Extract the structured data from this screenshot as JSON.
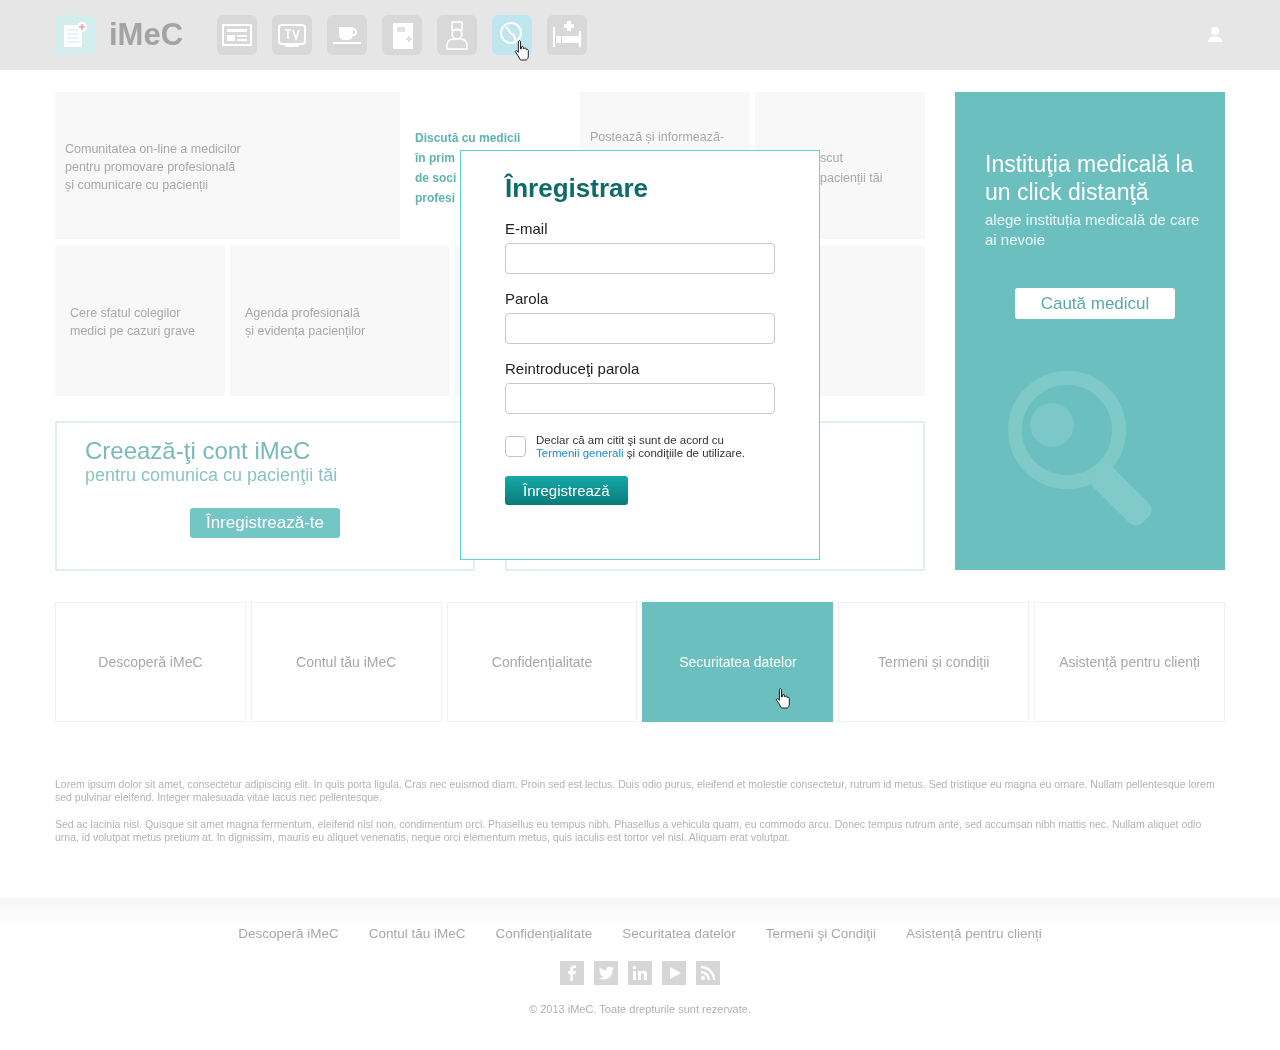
{
  "header": {
    "logo": "iMeC",
    "nav": [
      {
        "selected": false
      },
      {
        "selected": false
      },
      {
        "selected": false
      },
      {
        "selected": false
      },
      {
        "selected": false
      },
      {
        "selected": true
      },
      {
        "selected": false
      }
    ]
  },
  "features": {
    "row1": [
      {
        "lines": [
          "Comunitatea on-line a medicilor",
          "pentru promovare profesională",
          "și comunicare cu pacienții"
        ],
        "accent": false
      },
      {
        "lines": [
          "Discută cu medicii",
          "în prim",
          "de soci",
          "profesi"
        ],
        "accent": true
      },
      {
        "lines": [
          "Postează și informează-"
        ],
        "accent": false
      },
      {
        "lines": [
          "scut",
          "pacienții tăi"
        ],
        "accent": false
      }
    ],
    "row2": [
      {
        "lines": [
          "Cere sfatul colegilor",
          "medici pe cazuri grave"
        ]
      },
      {
        "lines": [
          "Agenda profesională",
          "și evidența pacienților"
        ]
      }
    ]
  },
  "promo": {
    "title": "Instituţia medicală la un click distanţă",
    "subtitle": "alege instituția medicală de care ai nevoie",
    "button": "Caută medicul"
  },
  "signup_box": {
    "title": "Creează-ţi cont iMeC",
    "subtitle": "pentru comunica cu pacienţii tăi",
    "button": "Înregistrează-te"
  },
  "tiles": [
    {
      "label": "Descoperă iMeC",
      "selected": false
    },
    {
      "label": "Contul tău iMeC",
      "selected": false
    },
    {
      "label": "Confidențialitate",
      "selected": false
    },
    {
      "label": "Securitatea datelor",
      "selected": true
    },
    {
      "label": "Termeni și condiții",
      "selected": false
    },
    {
      "label": "Asistență pentru clienți",
      "selected": false
    }
  ],
  "paragraphs": [
    "Lorem ipsum dolor sit amet, consectetur adipiscing elit. In quis porta ligula. Cras nec euismod diam. Proin sed est lectus. Duis odio purus, eleifend et molestie consectetur, rutrum id metus. Sed tristique eu magna eu ornare. Nullam pellentesque lorem sed pulvinar eleifend. Integer malesuada vitae lacus nec pellentesque.",
    "Sed ac lacinia nisl. Quisque sit amet magna fermentum, eleifend nisl non, condimentum orci. Phasellus eu tempus nibh. Phasellus a vehicula quam, eu commodo arcu. Donec tempus rutrum ante, sed accumsan nibh mattis nec. Nullam aliquet odio urna, id volutpat metus pretium at. In dignissim, mauris eu aliquet venenatis, neque orci elementum metus, quis iaculis est tortor vel nisl. Aliquam erat volutpat."
  ],
  "footer": {
    "links": [
      "Descoperă iMeC",
      "Contul tău iMeC",
      "Confidențialitate",
      "Securitatea datelor",
      "Termeni şi Condiţii",
      "Asistență pentru clienți"
    ],
    "copyright": "© 2013 iMeC. Toate drepturile sunt rezervate."
  },
  "modal": {
    "title": "Înregistrare",
    "fields": [
      {
        "label": "E-mail"
      },
      {
        "label": "Parola"
      },
      {
        "label": "Reintroduceţi parola"
      }
    ],
    "terms": {
      "checked": false,
      "before": "Declar că am citit şi sunt de acord cu",
      "link": "Termenii generali",
      "after": "şi condiţiile de utilizare."
    },
    "button": "Înregistrează"
  }
}
